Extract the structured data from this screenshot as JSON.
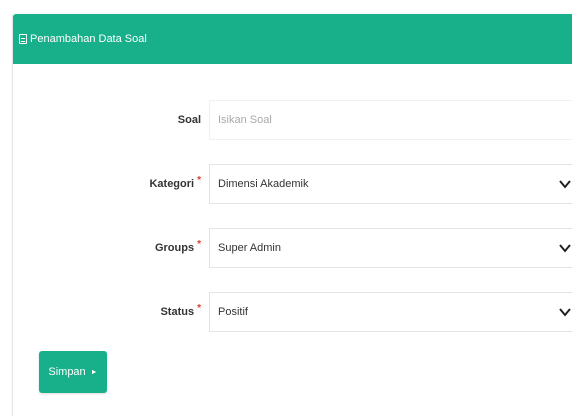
{
  "panel": {
    "title": "Penambahan Data Soal",
    "title_icon": "document-icon"
  },
  "form": {
    "soal": {
      "label": "Soal",
      "placeholder": "Isikan Soal",
      "value": ""
    },
    "kategori": {
      "label": "Kategori",
      "required_mark": "*",
      "value": "Dimensi Akademik"
    },
    "groups": {
      "label": "Groups",
      "required_mark": "*",
      "value": "Super Admin"
    },
    "status": {
      "label": "Status",
      "required_mark": "*",
      "value": "Positif"
    }
  },
  "buttons": {
    "save_label": "Simpan",
    "save_icon": "caret-right-icon"
  },
  "colors": {
    "accent": "#17b08a",
    "required": "#e53935"
  }
}
